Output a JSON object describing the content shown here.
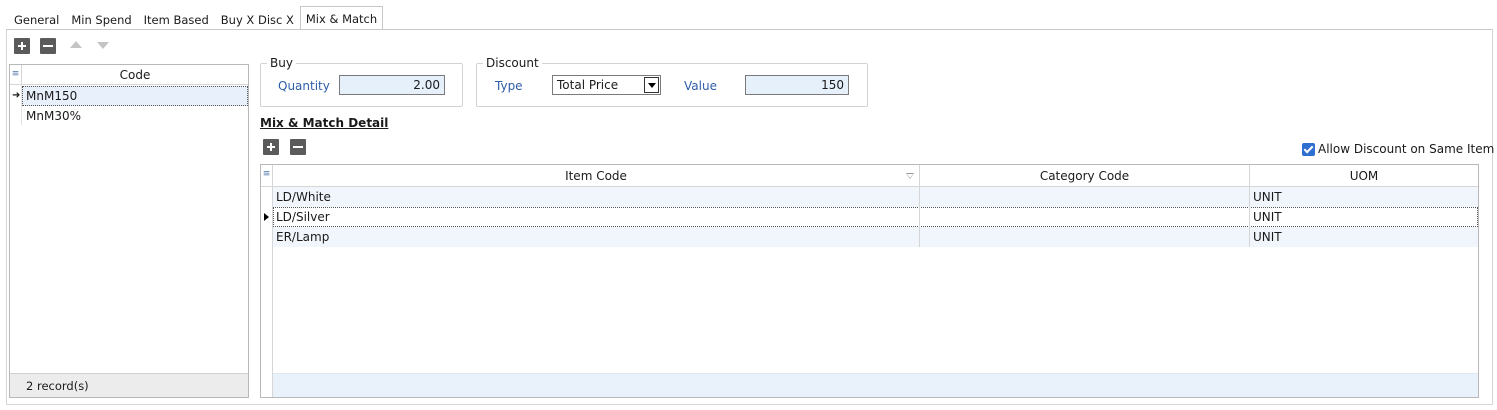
{
  "tabs": [
    {
      "label": "General"
    },
    {
      "label": "Min Spend"
    },
    {
      "label": "Item Based"
    },
    {
      "label": "Buy X Disc X"
    },
    {
      "label": "Mix & Match",
      "active": true
    }
  ],
  "icons": {
    "grid_corner": "grid-menu-icon",
    "add": "plus-icon",
    "remove": "minus-icon",
    "move_up": "arrow-up-icon",
    "move_down": "arrow-down-icon",
    "current_row": "row-pointer-icon",
    "filter": "filter-icon",
    "dropdown": "chevron-down-icon",
    "check": "checkbox-checked-icon"
  },
  "code_list": {
    "header": "Code",
    "rows": [
      "MnM150",
      "MnM30%"
    ],
    "selected_index": 0,
    "footer": "2 record(s)"
  },
  "buy": {
    "title": "Buy",
    "quantity_label": "Quantity",
    "quantity_value": "2.00"
  },
  "discount": {
    "title": "Discount",
    "type_label": "Type",
    "type_value": "Total Price",
    "value_label": "Value",
    "value_value": "150"
  },
  "detail": {
    "title": "Mix & Match Detail",
    "allow_same_item_label": "Allow Discount on Same Item",
    "allow_same_item_checked": true,
    "columns": [
      "Item Code",
      "Category Code",
      "UOM"
    ],
    "rows": [
      {
        "item_code": "LD/White",
        "category_code": "",
        "uom": "UNIT"
      },
      {
        "item_code": "LD/Silver",
        "category_code": "",
        "uom": "UNIT"
      },
      {
        "item_code": "ER/Lamp",
        "category_code": "",
        "uom": "UNIT"
      }
    ],
    "selected_index": 1
  },
  "colors": {
    "accent": "#2f6fcf",
    "label_blue": "#2f5fa8",
    "field_bg": "#e6f0fa",
    "grid_alt": "#f1f6fc"
  }
}
